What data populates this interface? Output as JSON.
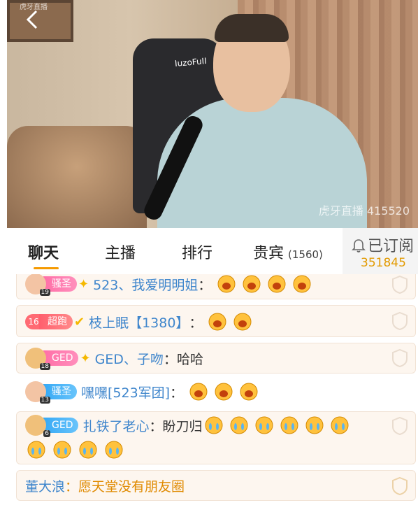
{
  "video": {
    "watermark_top": "虎牙直播",
    "watermark": "虎牙直播 415520",
    "chair_logo": "IuzoFuII"
  },
  "tabs": {
    "chat": "聊天",
    "host": "主播",
    "rank": "排行",
    "vip": "贵宾",
    "vip_count": "(1560)"
  },
  "subscribe": {
    "label": "已订阅",
    "count": "351845"
  },
  "chat": [
    {
      "level": "19",
      "badge": "骚圣",
      "name": "523、我爱明明姐",
      "text": "",
      "emojis": 4
    },
    {
      "level": "16",
      "badge": "超跑",
      "name": "枝上眠【1380】",
      "text": "",
      "emojis": 2
    },
    {
      "level": "18",
      "badge": "GED",
      "name": "GED、子吻",
      "text": "哈哈",
      "emojis": 0
    },
    {
      "level": "13",
      "badge": "骚圣",
      "name": "嘿嘿[523军团]",
      "text": "",
      "emojis": 3
    },
    {
      "level": "6",
      "badge": "GED",
      "name": "扎铁了老心",
      "text": "盼刀归",
      "emojis": 10
    },
    {
      "level": "",
      "badge": "",
      "name": "董大浪",
      "text": "愿天堂没有朋友圈",
      "emojis": 0
    }
  ],
  "colors": {
    "accent": "#f59a00",
    "name": "#3f86cc",
    "subscribe_count": "#e29a00"
  }
}
